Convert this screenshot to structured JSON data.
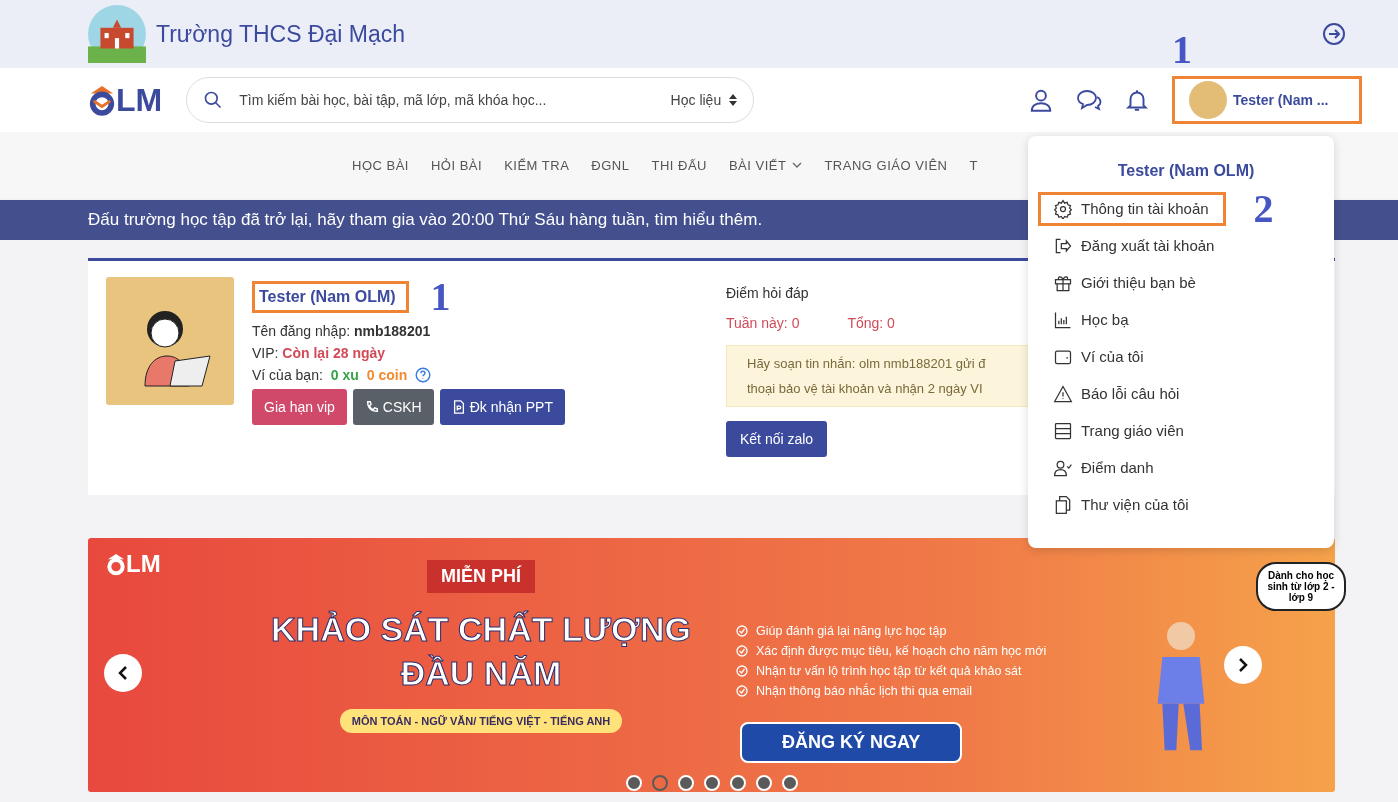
{
  "school": {
    "name": "Trường THCS Đại Mạch"
  },
  "header": {
    "logo": "LM",
    "search_placeholder": "Tìm kiếm bài học, bài tập, mã lớp, mã khóa học...",
    "filter": "Học liệu",
    "user": "Tester (Nam ...",
    "annotation": "1"
  },
  "nav": [
    {
      "label": "HỌC BÀI",
      "has_menu": false
    },
    {
      "label": "HỎI BÀI",
      "has_menu": false
    },
    {
      "label": "KIỂM TRA",
      "has_menu": false
    },
    {
      "label": "ĐGNL",
      "has_menu": false
    },
    {
      "label": "THI ĐẤU",
      "has_menu": false
    },
    {
      "label": "BÀI VIẾT",
      "has_menu": true
    },
    {
      "label": "TRANG GIÁO VIÊN",
      "has_menu": false
    },
    {
      "label": "T",
      "has_menu": false
    }
  ],
  "announcement": "Đấu trường học tập đã trở lại, hãy tham gia vào 20:00 Thứ Sáu hàng tuần, tìm hiểu thêm.",
  "profile": {
    "name": "Tester (Nam OLM)",
    "annotation": "1",
    "login_label": "Tên đăng nhập:",
    "login": "nmb188201",
    "vip_label": "VIP:",
    "vip": "Còn lại 28 ngày",
    "wallet_label": "Ví của bạn:",
    "xu": "0 xu",
    "coin": "0 coin",
    "buttons": [
      {
        "label": "Gia hạn vip",
        "kind": "vip"
      },
      {
        "label": "CSKH",
        "kind": "support"
      },
      {
        "label": "Đk nhận PPT",
        "kind": "ppt"
      }
    ]
  },
  "qa": {
    "title": "Điểm hỏi đáp",
    "week": "Tuần này: 0",
    "total": "Tổng: 0",
    "notice": [
      "Hãy soạn tin nhắn: olm nmb188201 gửi đ",
      "thoại bảo vệ tài khoản và nhận 2 ngày VI"
    ],
    "button": "Kết nối zalo"
  },
  "menu": {
    "title": "Tester (Nam OLM)",
    "annotation": "2",
    "items": [
      {
        "label": "Thông tin tài khoản",
        "kind": "gear",
        "highlighted": true
      },
      {
        "label": "Đăng xuất tài khoản",
        "kind": "logout",
        "highlighted": false
      },
      {
        "label": "Giới thiệu bạn bè",
        "kind": "gift",
        "highlighted": false
      },
      {
        "label": "Học bạ",
        "kind": "chart",
        "highlighted": false
      },
      {
        "label": "Ví của tôi",
        "kind": "wallet",
        "highlighted": false
      },
      {
        "label": "Báo lỗi câu hỏi",
        "kind": "warning",
        "highlighted": false
      },
      {
        "label": "Trang giáo viên",
        "kind": "server",
        "highlighted": false
      },
      {
        "label": "Điểm danh",
        "kind": "usercheck",
        "highlighted": false
      },
      {
        "label": "Thư viện của tôi",
        "kind": "copy",
        "highlighted": false
      }
    ]
  },
  "banner": {
    "logo": "LM",
    "tag": "MIỄN PHÍ",
    "title": [
      "KHẢO SÁT CHẤT LƯỢNG",
      "ĐẦU NĂM"
    ],
    "subjects": "MÔN TOÁN - NGỮ VĂN/ TIẾNG VIỆT - TIẾNG ANH",
    "points": [
      "Giúp đánh giá lại năng lực học tập",
      "Xác định được mục tiêu, kế hoạch cho năm học mới",
      "Nhận tư vấn lộ trình học tập từ kết quả khảo sát",
      "Nhận thông báo nhắc lịch thi qua email"
    ],
    "cta": "ĐĂNG KÝ NGAY",
    "badge": "Dành cho học sinh từ lớp 2 - lớp 9",
    "dots": [
      {
        "selected": false
      },
      {
        "selected": true
      },
      {
        "selected": false
      },
      {
        "selected": false
      },
      {
        "selected": false
      },
      {
        "selected": false
      },
      {
        "selected": false
      }
    ]
  }
}
